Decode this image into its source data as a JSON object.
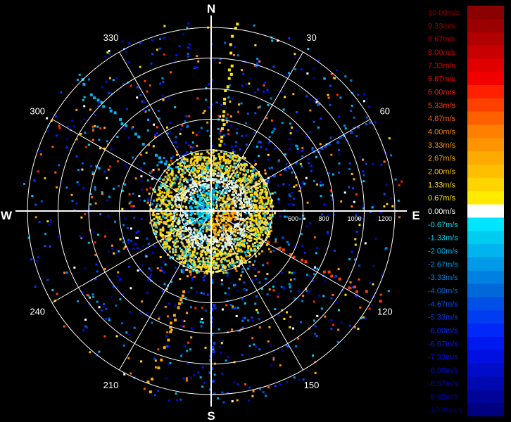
{
  "radar": {
    "compass": {
      "north": "N",
      "east": "E",
      "south": "S",
      "west": "W"
    },
    "azimuth_labels": [
      {
        "text": "30",
        "angle": 30
      },
      {
        "text": "60",
        "angle": 60
      },
      {
        "text": "120",
        "angle": 120
      },
      {
        "text": "150",
        "angle": 150
      },
      {
        "text": "210",
        "angle": 210
      },
      {
        "text": "240",
        "angle": 240
      },
      {
        "text": "300",
        "angle": 300
      },
      {
        "text": "330",
        "angle": 330
      }
    ],
    "range_labels": [
      {
        "text": "600",
        "ring": 3
      },
      {
        "text": "800",
        "ring": 4
      },
      {
        "text": "1000",
        "ring": 5
      },
      {
        "text": "1200",
        "ring": 6
      }
    ],
    "colors": {
      "grid": "#ffffff",
      "background": "#000000",
      "label": "#ffffff"
    }
  },
  "colorbar": {
    "entries": [
      {
        "label": "10.00m/s",
        "color": "#8b0000"
      },
      {
        "label": "9.33m/s",
        "color": "#9a0000"
      },
      {
        "label": "8.67m/s",
        "color": "#b00000"
      },
      {
        "label": "8.00m/s",
        "color": "#c80000"
      },
      {
        "label": "7.33m/s",
        "color": "#e00000"
      },
      {
        "label": "6.67m/s",
        "color": "#f20000"
      },
      {
        "label": "6.00m/s",
        "color": "#ff2000"
      },
      {
        "label": "5.33m/s",
        "color": "#ff4000"
      },
      {
        "label": "4.67m/s",
        "color": "#ff6000"
      },
      {
        "label": "4.00m/s",
        "color": "#ff7f00"
      },
      {
        "label": "3.33m/s",
        "color": "#ff9400"
      },
      {
        "label": "2.67m/s",
        "color": "#ffaa00"
      },
      {
        "label": "2.00m/s",
        "color": "#ffbf00"
      },
      {
        "label": "1.33m/s",
        "color": "#ffd400"
      },
      {
        "label": "0.67m/s",
        "color": "#ffea00"
      },
      {
        "label": "0.00m/s",
        "color": "#ffffff"
      },
      {
        "label": "-0.67m/s",
        "color": "#00e5ff"
      },
      {
        "label": "-1.33m/s",
        "color": "#00ccf0"
      },
      {
        "label": "-2.00m/s",
        "color": "#00b4ee"
      },
      {
        "label": "-2.67m/s",
        "color": "#009ae8"
      },
      {
        "label": "-3.33m/s",
        "color": "#0080e0"
      },
      {
        "label": "-4.00m/s",
        "color": "#0068d8"
      },
      {
        "label": "-4.67m/s",
        "color": "#0050e8"
      },
      {
        "label": "-5.33m/s",
        "color": "#003cf0"
      },
      {
        "label": "-6.00m/s",
        "color": "#0028f8"
      },
      {
        "label": "-6.67m/s",
        "color": "#0018f0"
      },
      {
        "label": "-7.33m/s",
        "color": "#0010e0"
      },
      {
        "label": "-8.00m/s",
        "color": "#000cc8"
      },
      {
        "label": "-8.67m/s",
        "color": "#0008b0"
      },
      {
        "label": "-9.33m/s",
        "color": "#000498"
      },
      {
        "label": "-10.00m/s",
        "color": "#000080"
      }
    ]
  }
}
